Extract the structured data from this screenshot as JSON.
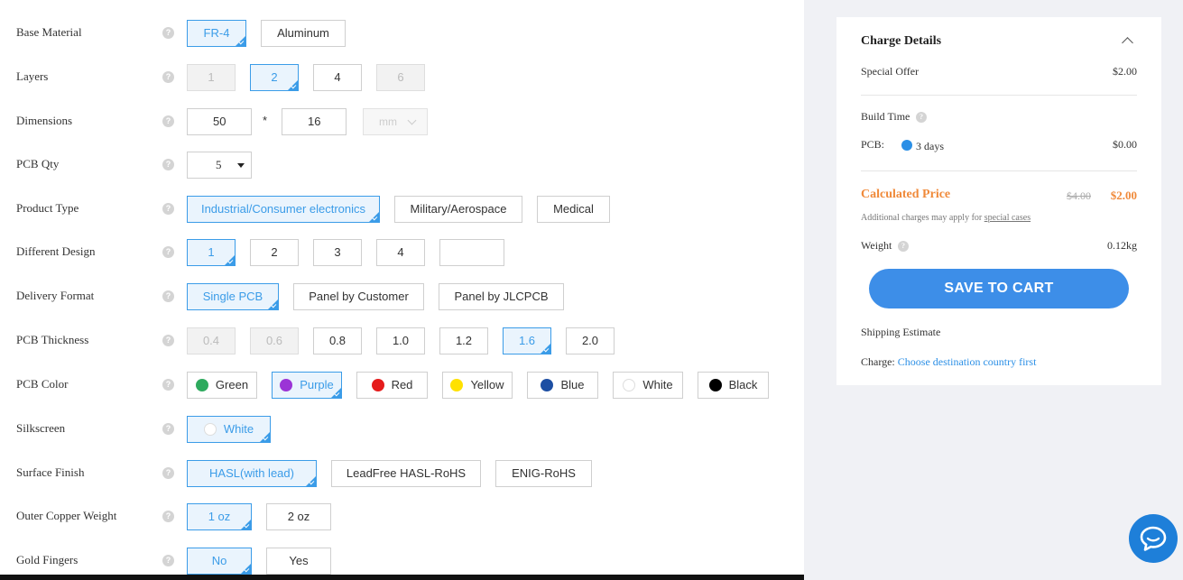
{
  "form": {
    "base_material": {
      "label": "Base Material",
      "options": [
        "FR-4",
        "Aluminum"
      ]
    },
    "layers": {
      "label": "Layers",
      "options": [
        "1",
        "2",
        "4",
        "6"
      ]
    },
    "dimensions": {
      "label": "Dimensions",
      "width": "50",
      "separator": "*",
      "height": "16",
      "unit": "mm"
    },
    "pcb_qty": {
      "label": "PCB Qty",
      "value": "5"
    },
    "product_type": {
      "label": "Product Type",
      "options": [
        "Industrial/Consumer electronics",
        "Military/Aerospace",
        "Medical"
      ]
    },
    "different_design": {
      "label": "Different Design",
      "options": [
        "1",
        "2",
        "3",
        "4"
      ],
      "custom": ""
    },
    "delivery_format": {
      "label": "Delivery Format",
      "options": [
        "Single PCB",
        "Panel by Customer",
        "Panel by JLCPCB"
      ]
    },
    "pcb_thickness": {
      "label": "PCB Thickness",
      "options": [
        "0.4",
        "0.6",
        "0.8",
        "1.0",
        "1.2",
        "1.6",
        "2.0"
      ]
    },
    "pcb_color": {
      "label": "PCB Color",
      "options": [
        "Green",
        "Purple",
        "Red",
        "Yellow",
        "Blue",
        "White",
        "Black"
      ],
      "colors": [
        "#2eaa5e",
        "#9b34d6",
        "#e51c1c",
        "#ffe100",
        "#1d4fa3",
        "#ffffff",
        "#000000"
      ]
    },
    "silkscreen": {
      "label": "Silkscreen",
      "options": [
        "White"
      ]
    },
    "surface_finish": {
      "label": "Surface Finish",
      "options": [
        "HASL(with lead)",
        "LeadFree HASL-RoHS",
        "ENIG-RoHS"
      ]
    },
    "outer_copper_weight": {
      "label": "Outer Copper Weight",
      "options": [
        "1 oz",
        "2 oz"
      ]
    },
    "gold_fingers": {
      "label": "Gold Fingers",
      "options": [
        "No",
        "Yes"
      ]
    },
    "help_glyph": "?"
  },
  "charges": {
    "title": "Charge Details",
    "special_offer_label": "Special Offer",
    "special_offer_value": "$2.00",
    "build_time_label": "Build Time",
    "pcb_label": "PCB:",
    "pcb_days": "3 days",
    "pcb_value": "$0.00",
    "calculated_label": "Calculated Price",
    "old_price": "$4.00",
    "new_price": "$2.00",
    "note_prefix": "Additional charges may apply for ",
    "note_link": "special cases",
    "weight_label": "Weight",
    "weight_value": "0.12kg",
    "cart_button": "SAVE TO CART",
    "shipping_label": "Shipping Estimate",
    "charge_label": "Charge:",
    "charge_link": "Choose destination country first"
  },
  "colors": {
    "accent": "#3b9ce8",
    "price": "#f08a3a",
    "cart": "#3d8ee8"
  },
  "icons": {
    "help": "question-circle-icon",
    "chat": "chat-bubble-icon",
    "collapse": "chevron-up-icon"
  }
}
